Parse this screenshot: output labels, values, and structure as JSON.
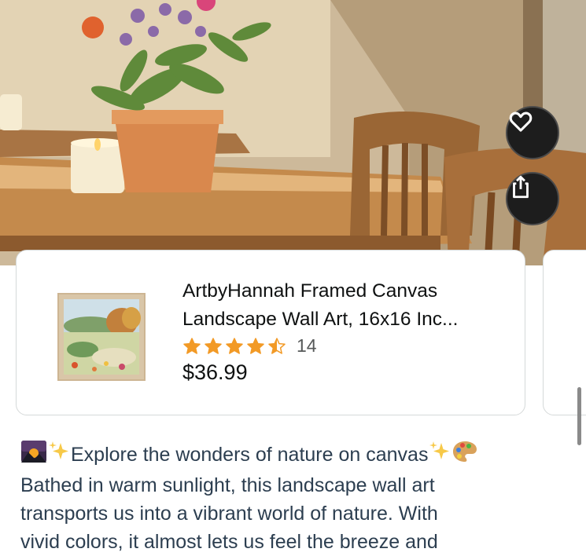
{
  "post": {
    "actions": {
      "like_icon": "heart-icon",
      "share_icon": "share-icon"
    }
  },
  "product": {
    "title": "ArtbyHannah Framed Canvas\nLandscape Wall Art, 16x16 Inc...",
    "rating": 4.5,
    "rating_max": 5,
    "rating_count": "14",
    "price": "$36.99",
    "star_color": "#f29a26"
  },
  "description": {
    "line1": "Explore the wonders of nature on canvas",
    "line2": "Bathed in warm sunlight, this landscape wall art",
    "line3": "transports us into a vibrant world of nature. With",
    "line4": "vivid colors, it almost lets us feel the breeze and"
  }
}
